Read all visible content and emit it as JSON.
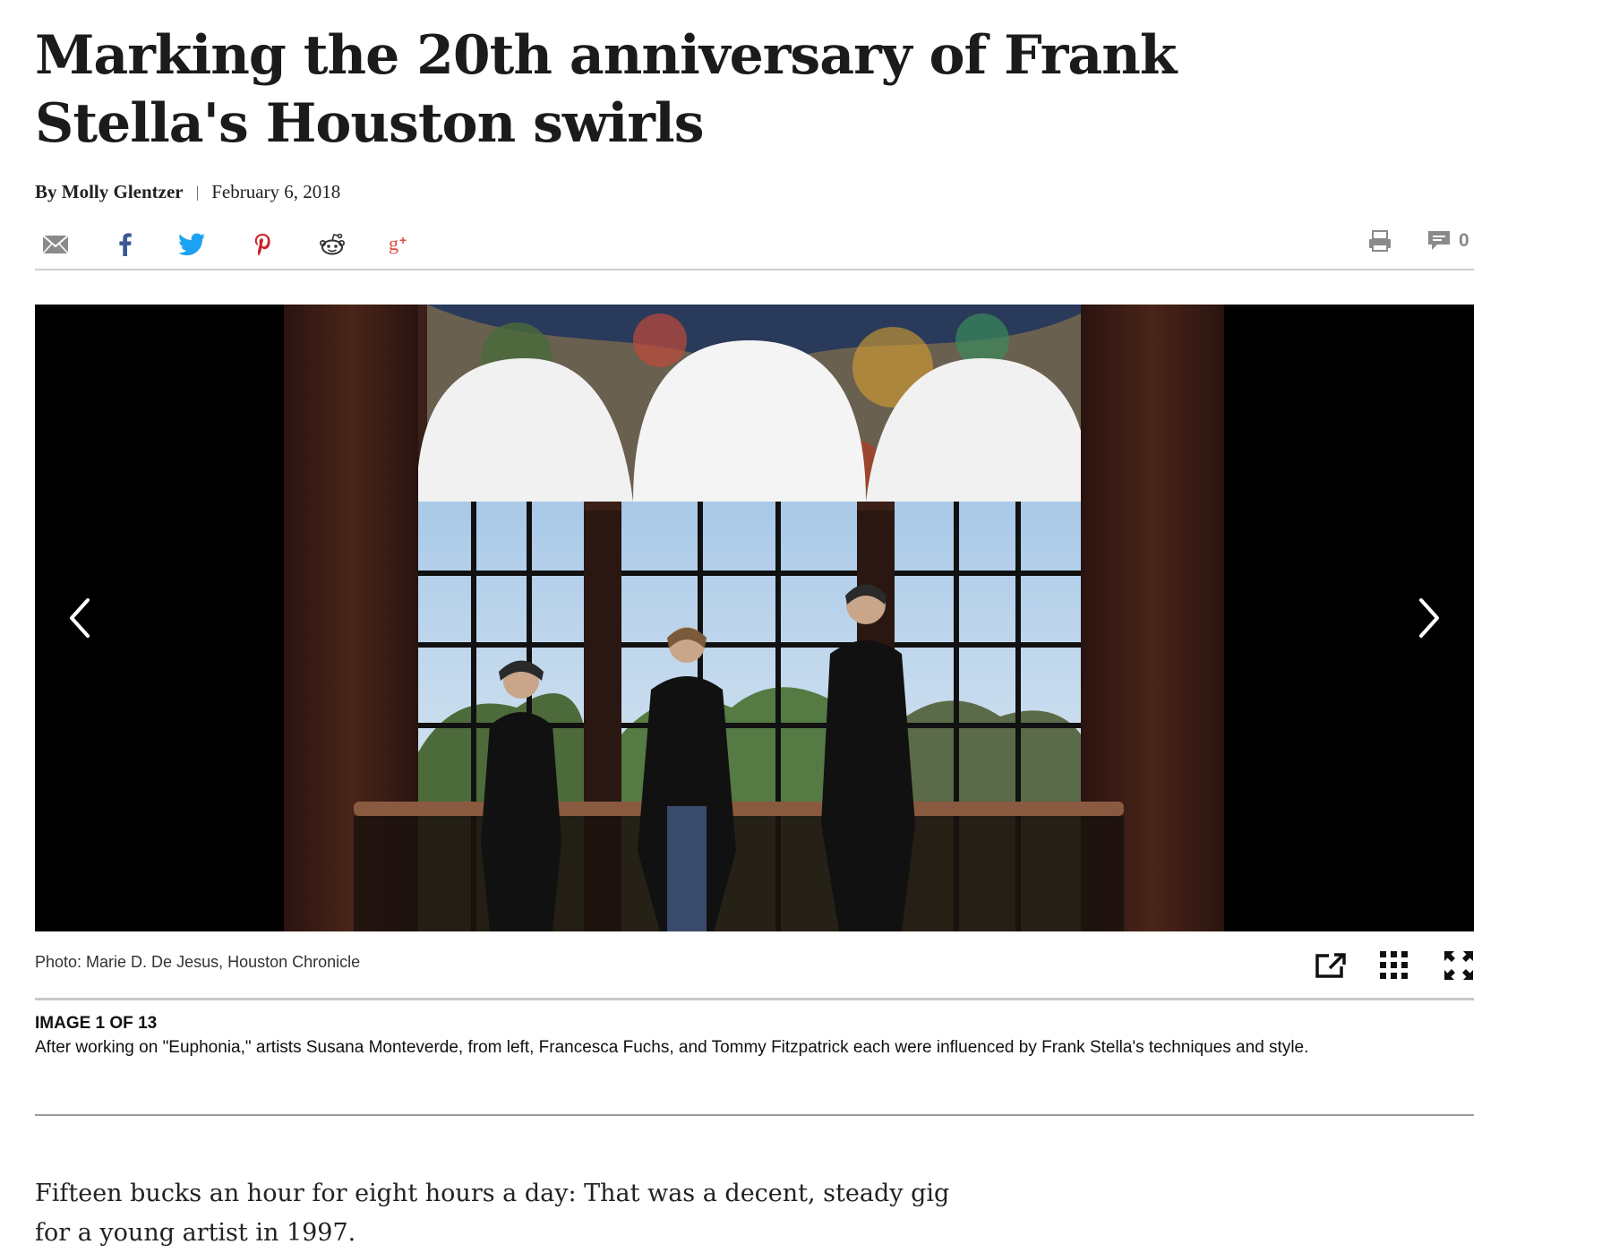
{
  "article": {
    "headline": "Marking the 20th anniversary of Frank Stella's Houston swirls",
    "byline_author": "By Molly Glentzer",
    "byline_separator": "|",
    "date": "February 6, 2018"
  },
  "share": {
    "icons": [
      "email-icon",
      "facebook-icon",
      "twitter-icon",
      "pinterest-icon",
      "reddit-icon",
      "google-plus-icon"
    ],
    "print_icon": "print-icon",
    "comment_icon": "comment-icon",
    "comment_count": "0",
    "colors": {
      "email": "#8a8a8a",
      "facebook": "#3b5998",
      "twitter": "#1da1f2",
      "pinterest": "#cb2027",
      "reddit": "#333333",
      "google_plus": "#dd4b39"
    }
  },
  "gallery": {
    "prev_icon": "chevron-left-icon",
    "next_icon": "chevron-right-icon",
    "photo_credit": "Photo: Marie D. De Jesus, Houston Chronicle",
    "tools": [
      "external-link-icon",
      "grid-icon",
      "fullscreen-icon"
    ],
    "image_counter": "IMAGE 1 OF 13",
    "caption": "After working on \"Euphonia,\" artists Susana Monteverde, from left, Francesca Fuchs, and Tommy Fitzpatrick each were influenced by Frank Stella's techniques and style."
  },
  "body": {
    "paragraph_1": "Fifteen bucks an hour for eight hours a day: That was a decent, steady gig for a young artist in 1997."
  }
}
